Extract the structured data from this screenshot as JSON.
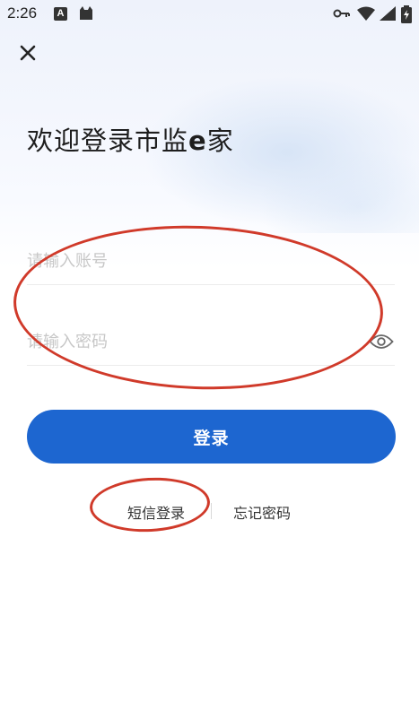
{
  "status_bar": {
    "time": "2:26",
    "notification_icons": [
      "a-box-icon",
      "cat-icon"
    ],
    "system_icons": [
      "vpn-key-icon",
      "wifi-icon",
      "signal-icon",
      "battery-icon"
    ],
    "badge_letter": "A"
  },
  "header": {
    "close_icon": "close-icon"
  },
  "title": {
    "prefix": "欢迎登录市监",
    "bold": "e",
    "suffix": "家"
  },
  "form": {
    "account_placeholder": "请输入账号",
    "account_value": "",
    "password_placeholder": "请输入密码",
    "password_value": "",
    "password_toggle_icon": "eye-icon",
    "login_label": "登录"
  },
  "links": {
    "sms_login": "短信登录",
    "forgot_password": "忘记密码"
  },
  "colors": {
    "primary": "#1d66d0",
    "annotation": "#d03a2a",
    "placeholder": "#c7c7c7"
  }
}
